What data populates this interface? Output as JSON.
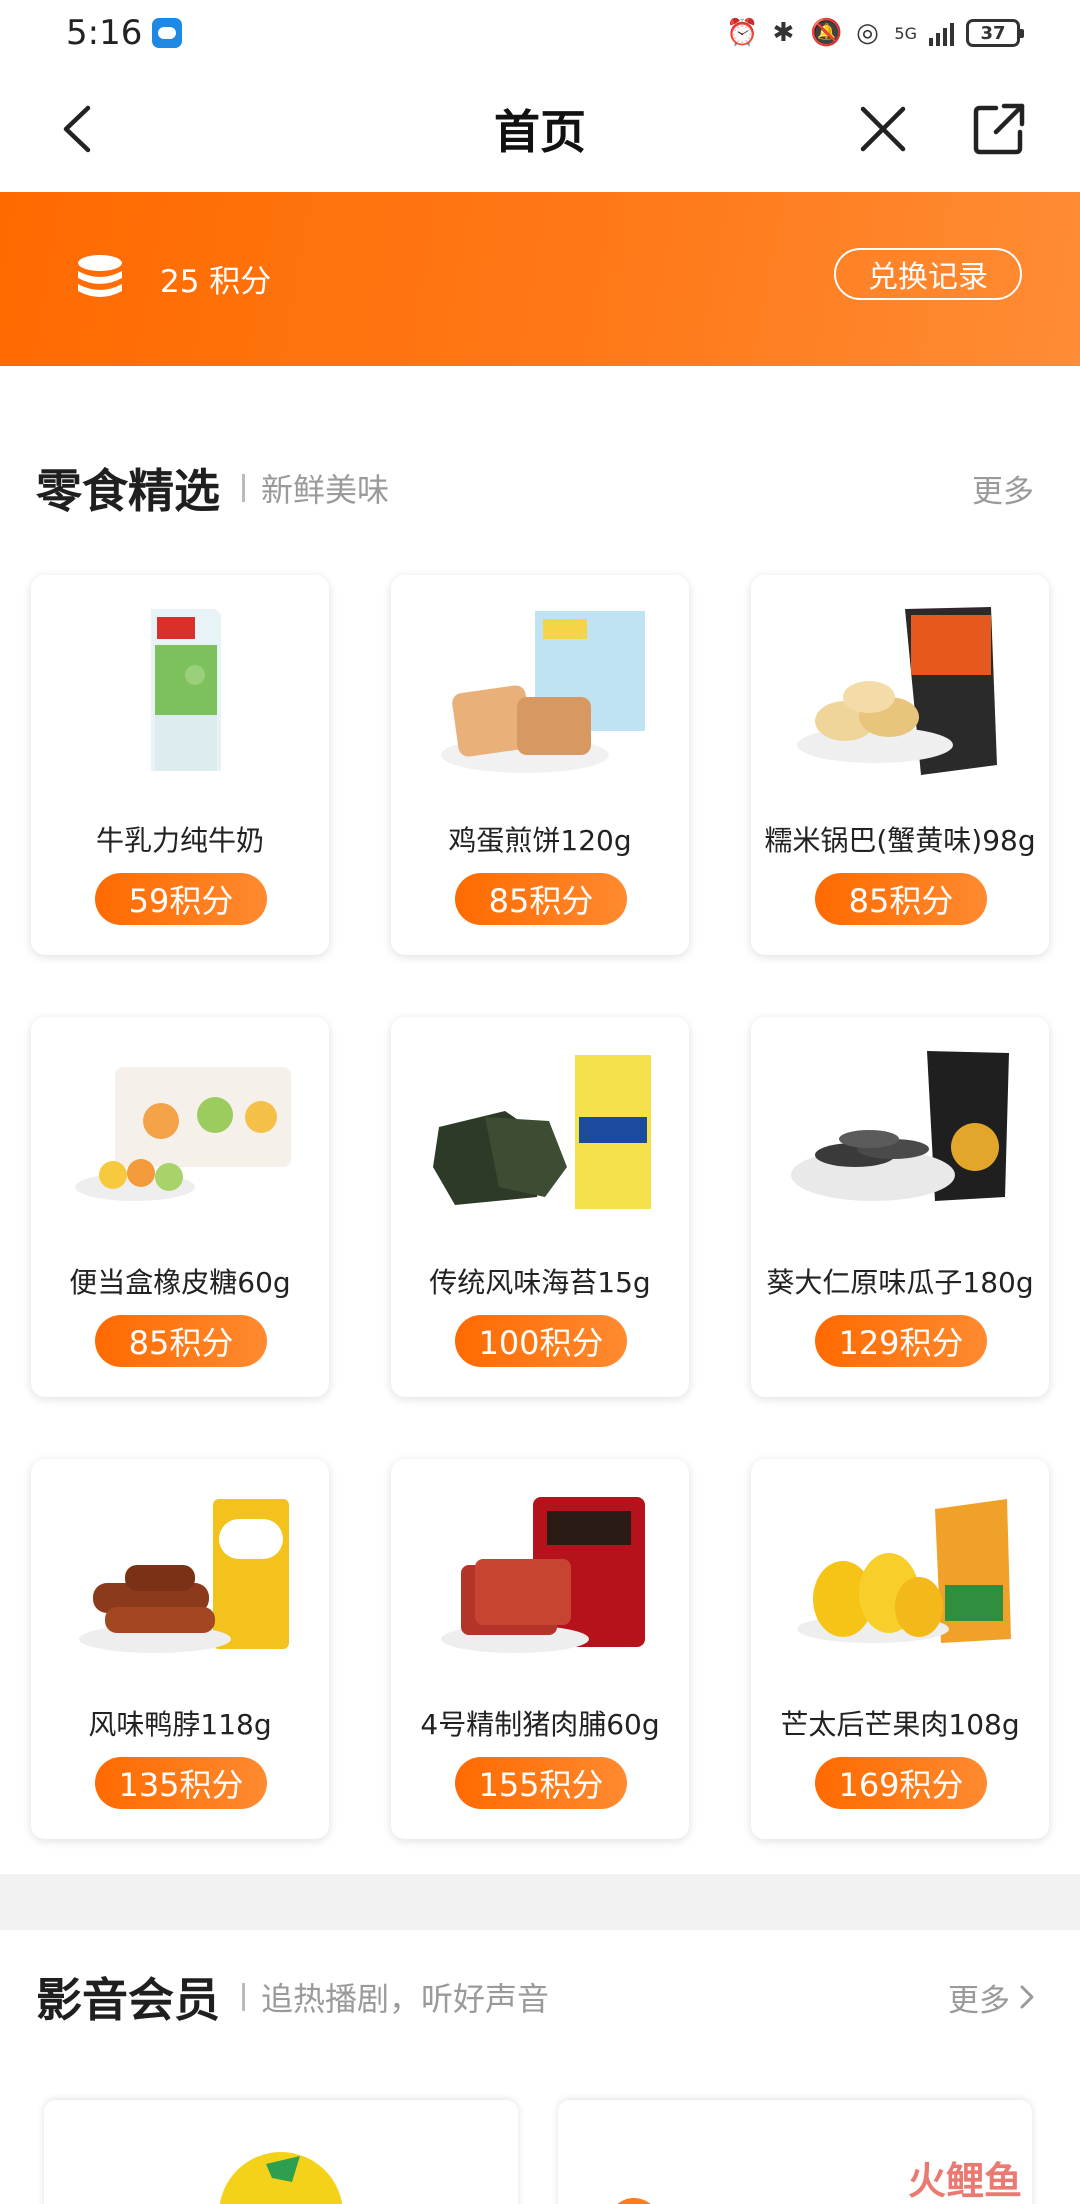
{
  "status_bar": {
    "time": "5:16",
    "network": "5G",
    "battery": "37"
  },
  "header": {
    "title": "首页",
    "back_icon": "chevron-left-icon",
    "close_icon": "close-icon",
    "share_icon": "share-external-icon"
  },
  "points": {
    "text": "25 积分",
    "history_label": "兑换记录"
  },
  "snacks": {
    "title": "零食精选",
    "subtitle": "新鲜美味",
    "more": "更多",
    "products": [
      {
        "name": "牛乳力纯牛奶",
        "price": "59积分"
      },
      {
        "name": "鸡蛋煎饼120g",
        "price": "85积分"
      },
      {
        "name": "糯米锅巴(蟹黄味)98g",
        "price": "85积分"
      },
      {
        "name": "便当盒橡皮糖60g",
        "price": "85积分"
      },
      {
        "name": "传统风味海苔15g",
        "price": "100积分"
      },
      {
        "name": "葵大仁原味瓜子180g",
        "price": "129积分"
      },
      {
        "name": "风味鸭脖118g",
        "price": "135积分"
      },
      {
        "name": "4号精制猪肉脯60g",
        "price": "155积分"
      },
      {
        "name": "芒太后芒果肉108g",
        "price": "169积分"
      }
    ]
  },
  "media": {
    "title": "影音会员",
    "subtitle": "追热播剧，听好声音",
    "more": "更多"
  },
  "watermark": "火鲤鱼",
  "colors": {
    "accent": "#ff6a00",
    "banner_end": "#ff8c36"
  }
}
